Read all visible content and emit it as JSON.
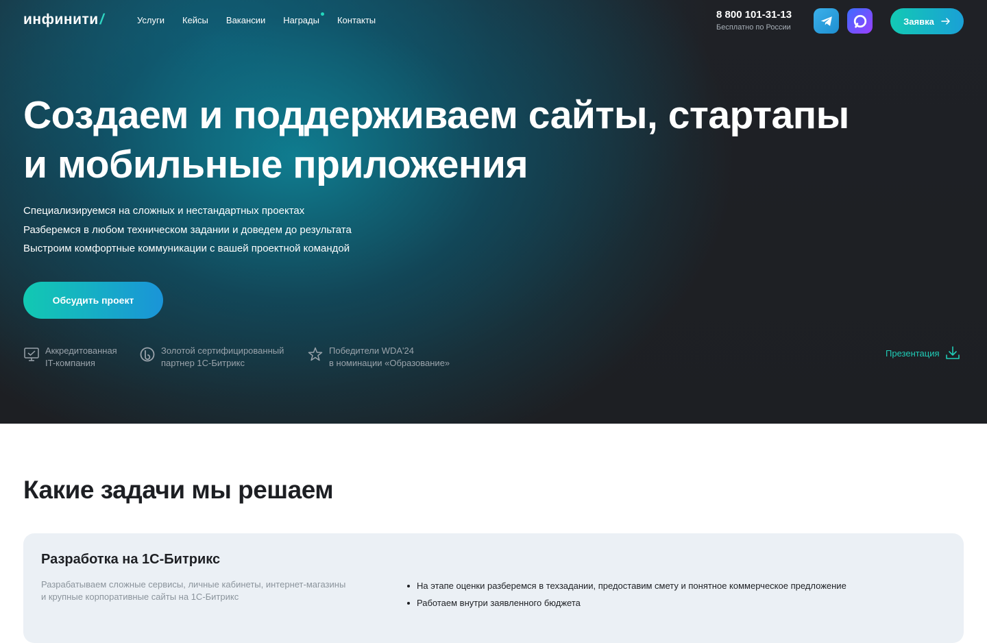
{
  "header": {
    "logo_text": "инфинити",
    "logo_slash": "/",
    "nav": [
      {
        "label": "Услуги"
      },
      {
        "label": "Кейсы"
      },
      {
        "label": "Вакансии"
      },
      {
        "label": "Награды",
        "has_dot": true
      },
      {
        "label": "Контакты"
      }
    ],
    "phone": "8 800 101-31-13",
    "phone_note": "Бесплатно по России",
    "telegram_icon": "telegram-icon",
    "max_icon": "max-messenger-icon",
    "request_label": "Заявка"
  },
  "hero": {
    "headline_line1": "Создаем и поддерживаем сайты, стартапы",
    "headline_line2": "и мобильные приложения",
    "bullets": [
      "Специализируемся на сложных и нестандартных проектах",
      "Разберемся в любом техническом задании и доведем до результата",
      "Выстроим комфортные коммуникации с вашей проектной командой"
    ],
    "cta_label": "Обсудить проект",
    "badges": [
      {
        "icon": "monitor-check-icon",
        "line1": "Аккредитованная",
        "line2": "IT-компания"
      },
      {
        "icon": "bitrix-icon",
        "line1": "Золотой сертифицированный",
        "line2": "партнер 1С-Битрикс"
      },
      {
        "icon": "award-star-icon",
        "line1": "Победители WDA'24",
        "line2": "в номинации «Образование»"
      }
    ],
    "presentation_label": "Презентация",
    "presentation_icon": "download-icon"
  },
  "tasks": {
    "title": "Какие задачи мы решаем",
    "card": {
      "title": "Разработка на 1С-Битрикс",
      "desc_line1": "Разрабатываем сложные сервисы, личные кабинеты, интернет-магазины",
      "desc_line2": "и крупные корпоративные сайты на 1С-Битрикс",
      "points": [
        "На этапе оценки разберемся в техзадании, предоставим смету и понятное коммерческое предложение",
        "Работаем внутри заявленного бюджета"
      ]
    }
  },
  "colors": {
    "accent": "#20cdb8",
    "dark_bg": "#1d1f23",
    "card_bg": "#ebf0f5"
  }
}
